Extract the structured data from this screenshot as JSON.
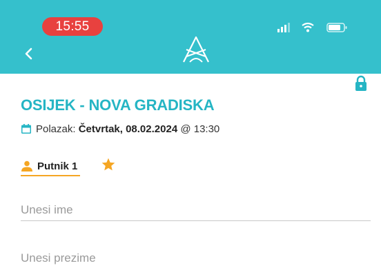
{
  "status_bar": {
    "time": "15:55",
    "icons": [
      "signal-icon",
      "wifi-icon",
      "battery-icon"
    ]
  },
  "header": {
    "back_icon": "chevron-left-icon",
    "logo_icon": "app-logo-icon",
    "background_color": "#35c0cc"
  },
  "trip": {
    "route": "OSIJEK - NOVA GRADISKA",
    "departure_label": "Polazak:",
    "departure_date": "Četvrtak, 08.02.2024",
    "at_symbol": "@",
    "departure_time": "13:30",
    "lock_icon": "lock-icon"
  },
  "passenger": {
    "tab_label": "Putnik 1",
    "star_icon": "star-icon"
  },
  "form": {
    "first_name_placeholder": "Unesi ime",
    "first_name_value": "",
    "last_name_placeholder": "Unesi prezime",
    "last_name_value": ""
  },
  "colors": {
    "accent": "#25b5c4",
    "highlight": "#f5a623",
    "time_pill": "#e8413f"
  }
}
